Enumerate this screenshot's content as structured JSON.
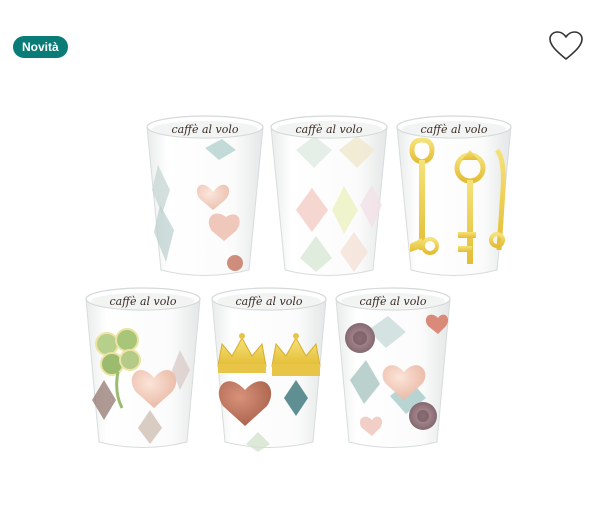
{
  "badge": {
    "label": "Novità",
    "color": "#0a7c78"
  },
  "favorite": {
    "icon": "heart-outline-icon",
    "color": "#333333"
  },
  "cups": {
    "inscription": "caffè al volo",
    "items": [
      {
        "design": "harlequin-hearts"
      },
      {
        "design": "pastel-harlequin"
      },
      {
        "design": "golden-keys"
      },
      {
        "design": "clover-hearts"
      },
      {
        "design": "crowns-heart"
      },
      {
        "design": "roses-hearts"
      }
    ]
  }
}
